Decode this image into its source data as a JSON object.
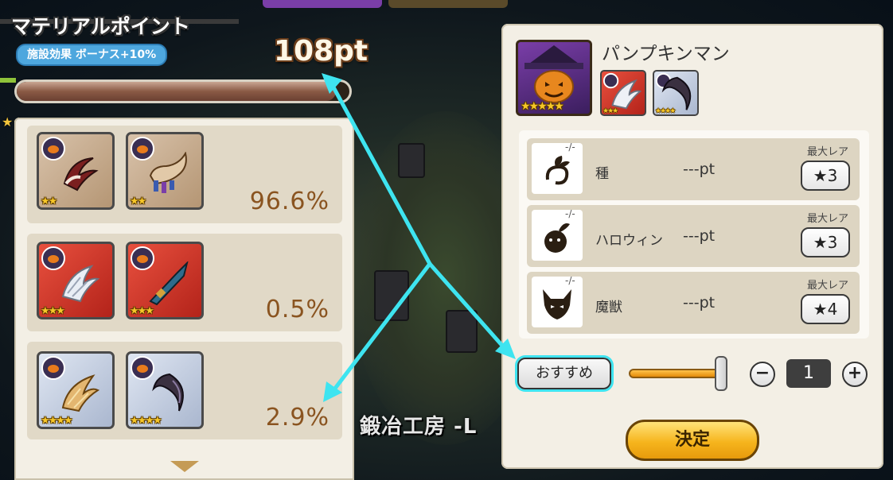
{
  "header": {
    "title": "マテリアルポイント",
    "bonus": "施設効果 ボーナス+10%",
    "points": "108pt",
    "progress": 0.96
  },
  "facility_label": "鍛冶工房 -L",
  "results": [
    {
      "percent": "96.6%",
      "rarity": 2,
      "items": [
        "claw-item-icon",
        "horn-item-icon"
      ]
    },
    {
      "percent": "0.5%",
      "rarity": 3,
      "items": [
        "claw-item-icon",
        "lance-item-icon"
      ]
    },
    {
      "percent": "2.9%",
      "rarity": 4,
      "items": [
        "claw-item-icon",
        "scythe-item-icon"
      ]
    }
  ],
  "character": {
    "name": "パンプキンマン",
    "rarity": 5,
    "materials": [
      {
        "icon": "claw-material-icon",
        "rarity": 3
      },
      {
        "icon": "scythe-material-icon",
        "rarity": 4
      }
    ]
  },
  "categories": [
    {
      "slash": "-/-",
      "name": "種",
      "pts": "---pt",
      "max_label": "最大レア",
      "max_rare": "★3",
      "icon": "seed-icon"
    },
    {
      "slash": "-/-",
      "name": "ハロウィン",
      "pts": "---pt",
      "max_label": "最大レア",
      "max_rare": "★3",
      "icon": "bomb-icon"
    },
    {
      "slash": "-/-",
      "name": "魔獣",
      "pts": "---pt",
      "max_label": "最大レア",
      "max_rare": "★4",
      "icon": "beast-icon"
    }
  ],
  "controls": {
    "recommend": "おすすめ",
    "minus": "−",
    "plus": "+",
    "quantity": "1",
    "confirm": "決定"
  },
  "colors": {
    "accent_cyan": "#3ee4f0",
    "percent_text": "#8a5420",
    "confirm_gold": "#f6b51d"
  }
}
